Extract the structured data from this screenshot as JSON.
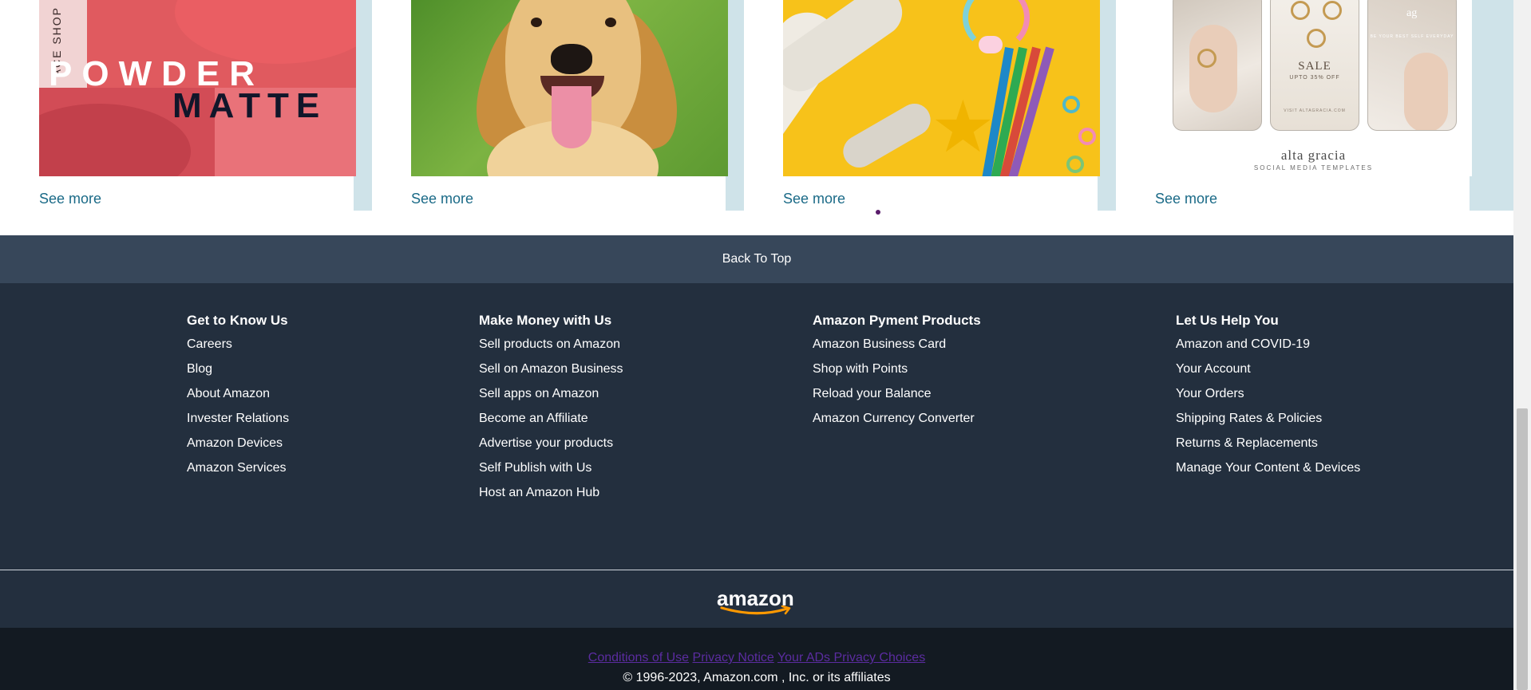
{
  "cards": [
    {
      "image_label": "POWDER MATTE lipstick image",
      "overlay_shop_text": "ACE SHOP",
      "overlay_line1": "POWDER",
      "overlay_line2": "MATTE",
      "link": "See more"
    },
    {
      "image_label": "Golden retriever puppy image",
      "link": "See more"
    },
    {
      "image_label": "Toy airplane and colored pencils image",
      "link": "See more"
    },
    {
      "image_label": "Alta Gracia jewelry social media templates image",
      "overlay_sale": "SALE",
      "overlay_sale_sub": "UPTO 35% OFF",
      "overlay_tagline": "BE YOUR BEST SELF EVERYDAY",
      "overlay_visit": "VISIT ALTAGRACIA.COM",
      "overlay_brand": "alta gracia",
      "overlay_brand_tag": "SOCIAL MEDIA TEMPLATES",
      "link": "See more"
    }
  ],
  "back_to_top": "Back To Top",
  "footer": {
    "columns": [
      {
        "heading": "Get to Know Us",
        "links": [
          "Careers",
          "Blog",
          "About Amazon",
          "Invester Relations",
          "Amazon Devices",
          "Amazon Services"
        ]
      },
      {
        "heading": "Make Money with Us",
        "links": [
          "Sell products on Amazon",
          "Sell on Amazon Business",
          "Sell apps on Amazon",
          "Become an Affiliate",
          "Advertise your products",
          "Self Publish with Us",
          "Host an Amazon Hub"
        ]
      },
      {
        "heading": "Amazon Pyment Products",
        "links": [
          "Amazon Business Card",
          "Shop with Points",
          "Reload your Balance",
          "Amazon Currency Converter"
        ]
      },
      {
        "heading": "Let Us Help You",
        "links": [
          "Amazon and COVID-19",
          "Your Account",
          "Your Orders",
          "Shipping Rates & Policies",
          "Returns & Replacements",
          "Manage Your Content & Devices"
        ]
      }
    ]
  },
  "logo": {
    "text": "amazon",
    "icon": "amazon-smile-logo"
  },
  "legal": {
    "links": [
      "Conditions of Use",
      "Privacy Notice",
      "Your ADs Privacy Choices"
    ],
    "copyright": "© 1996-2023, Amazon.com , Inc. or its affiliates"
  },
  "colors": {
    "link_blue": "#1a6a87",
    "back_to_top_bg": "#37475a",
    "footer_bg": "#232f3e",
    "legal_bg": "#131a22",
    "legal_link": "#5b2ca0",
    "logo_smile": "#ff9900"
  }
}
